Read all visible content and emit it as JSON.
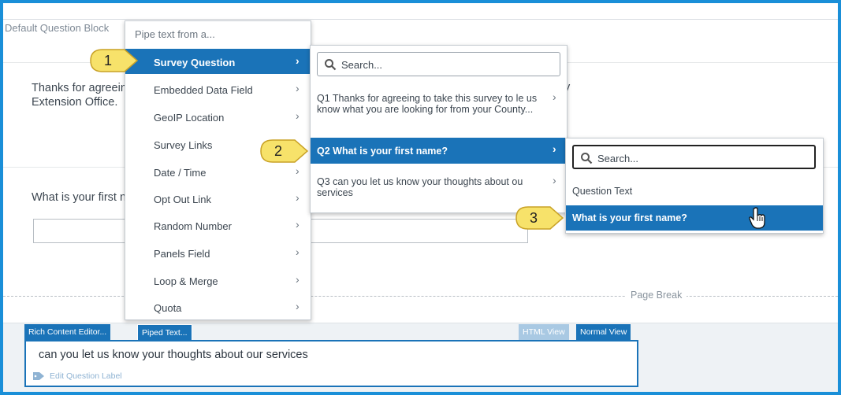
{
  "background": {
    "block_title": "Default Question Block",
    "q1_text_line1": "Thanks for agreeing to take this survey to let us know what you are looking for from your County",
    "q1_text_line2": "Extension Office.",
    "q1_tail": "y",
    "q2_text": "What is your first name?",
    "page_break": "Page Break"
  },
  "editor": {
    "tab_rich": "Rich Content Editor...",
    "tab_piped": "Piped Text...",
    "tab_html": "HTML View",
    "tab_normal": "Normal View",
    "content": "can you let us know your thoughts about our services",
    "edit_label": "Edit Question Label"
  },
  "menu1": {
    "title": "Pipe text from a...",
    "items": [
      {
        "label": "Survey Question",
        "selected": true
      },
      {
        "label": "Embedded Data Field"
      },
      {
        "label": "GeoIP Location"
      },
      {
        "label": "Survey Links"
      },
      {
        "label": "Date / Time"
      },
      {
        "label": "Opt Out Link"
      },
      {
        "label": "Random Number"
      },
      {
        "label": "Panels Field"
      },
      {
        "label": "Loop & Merge"
      },
      {
        "label": "Quota"
      }
    ],
    "chevron": "›"
  },
  "menu2": {
    "search_placeholder": "Search...",
    "items": [
      {
        "label": "Q1 Thanks for agreeing to take this survey to le us know what you are looking for from your County..."
      },
      {
        "label": "Q2 What is your first name?",
        "selected": true
      },
      {
        "label": "Q3 can you let us know your thoughts about ou services"
      }
    ]
  },
  "menu3": {
    "search_placeholder": "Search...",
    "items": [
      {
        "label": "Question Text"
      },
      {
        "label": "What is your first name?",
        "selected": true
      }
    ]
  },
  "callouts": [
    "1",
    "2",
    "3"
  ],
  "colors": {
    "accent": "#1a73b8",
    "frame": "#1a8fd8",
    "callout_fill": "#f7e26a",
    "callout_stroke": "#c9a227"
  },
  "icons": {
    "search": "search-icon",
    "chevron": "chevron-right-icon",
    "tag": "tag-icon",
    "cursor": "hand-pointer-icon"
  }
}
